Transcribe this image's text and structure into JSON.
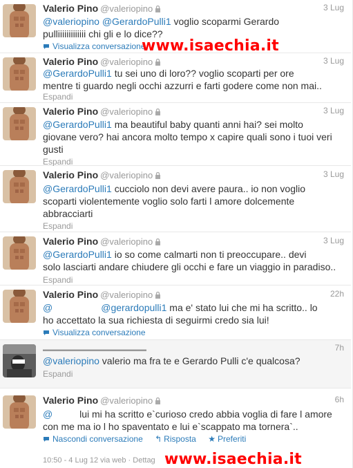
{
  "tweets": [
    {
      "name": "Valerio Pino",
      "handle": "@valeriopino",
      "time": "3 Lug",
      "lines": [
        [
          {
            "t": "@valeriopino",
            "m": true
          },
          {
            "t": " ",
            "m": false
          },
          {
            "t": "@GerardoPulli1",
            "m": true
          },
          {
            "t": " voglio scoparmi Gerardo",
            "m": false
          }
        ],
        [
          {
            "t": "pulliiiiiiiiiiiii chi gli e lo dice??",
            "m": false
          }
        ]
      ],
      "footer": "Visualizza conversazione"
    },
    {
      "name": "Valerio Pino",
      "handle": "@valeriopino",
      "time": "3 Lug",
      "lines": [
        [
          {
            "t": "@GerardoPulli1",
            "m": true
          },
          {
            "t": " tu sei uno di loro?? voglio scoparti per ore",
            "m": false
          }
        ],
        [
          {
            "t": "mentre ti guardo negli occhi azzurri e farti godere come non mai..",
            "m": false
          }
        ]
      ],
      "footer": "Espandi"
    },
    {
      "name": "Valerio Pino",
      "handle": "@valeriopino",
      "time": "3 Lug",
      "lines": [
        [
          {
            "t": "@GerardoPulli1",
            "m": true
          },
          {
            "t": " ma beautiful baby quanti anni hai? sei molto",
            "m": false
          }
        ],
        [
          {
            "t": "giovane vero? hai ancora molto tempo x capire quali sono i tuoi veri",
            "m": false
          }
        ],
        [
          {
            "t": "gusti",
            "m": false
          }
        ]
      ],
      "footer": "Espandi"
    },
    {
      "name": "Valerio Pino",
      "handle": "@valeriopino",
      "time": "3 Lug",
      "lines": [
        [
          {
            "t": "@GerardoPulli1",
            "m": true
          },
          {
            "t": " cucciolo non devi avere paura.. io non voglio",
            "m": false
          }
        ],
        [
          {
            "t": "scoparti violentemente voglio solo farti l amore dolcemente",
            "m": false
          }
        ],
        [
          {
            "t": "abbracciarti",
            "m": false
          }
        ]
      ],
      "footer": "Espandi"
    },
    {
      "name": "Valerio Pino",
      "handle": "@valeriopino",
      "time": "3 Lug",
      "lines": [
        [
          {
            "t": "@GerardoPulli1",
            "m": true
          },
          {
            "t": " io so come calmarti non ti preoccupare.. devi",
            "m": false
          }
        ],
        [
          {
            "t": "solo lasciarti andare chiudere gli occhi e fare un viaggio in paradiso..",
            "m": false
          }
        ]
      ],
      "footer": "Espandi"
    },
    {
      "name": "Valerio Pino",
      "handle": "@valeriopino",
      "time": "22h",
      "lines": [
        [
          {
            "t": "@",
            "m": true
          },
          {
            "t": "                  ",
            "m": false
          },
          {
            "t": "@gerardopulli1",
            "m": true
          },
          {
            "t": " ma e' stato lui che mi ha scritto.. lo",
            "m": false
          }
        ],
        [
          {
            "t": "ho accettato la sua richiesta di seguirmi credo sia lui!",
            "m": false
          }
        ]
      ],
      "footer": "Visualizza conversazione"
    },
    {
      "name": "",
      "handle": "",
      "time": "7h",
      "lines": [
        [
          {
            "t": "@valeriopino",
            "m": true
          },
          {
            "t": " valerio ma fra te e Gerardo Pulli c'e qualcosa?",
            "m": false
          }
        ]
      ],
      "footer": "Espandi"
    },
    {
      "name": "Valerio Pino",
      "handle": "@valeriopino",
      "time": "6h",
      "lines": [
        [
          {
            "t": "@",
            "m": true
          },
          {
            "t": "          lui mi ha scritto e`curioso credo abbia voglia di fare l amore",
            "m": false
          }
        ],
        [
          {
            "t": "con me ma io l ho spaventato e lui e`scappato ma tornera`..",
            "m": false
          }
        ]
      ],
      "footer": ""
    }
  ],
  "actions": {
    "hide": "Nascondi conversazione",
    "reply": "Risposta",
    "fav": "Preferiti"
  },
  "meta": {
    "date": "10:50 - 4 Lug 12 via web",
    "details": "Dettag"
  },
  "watermark": "www.isaechia.it",
  "colors": {
    "link": "#2b7bb9",
    "watermark": "#ff0000",
    "muted": "#999999"
  }
}
